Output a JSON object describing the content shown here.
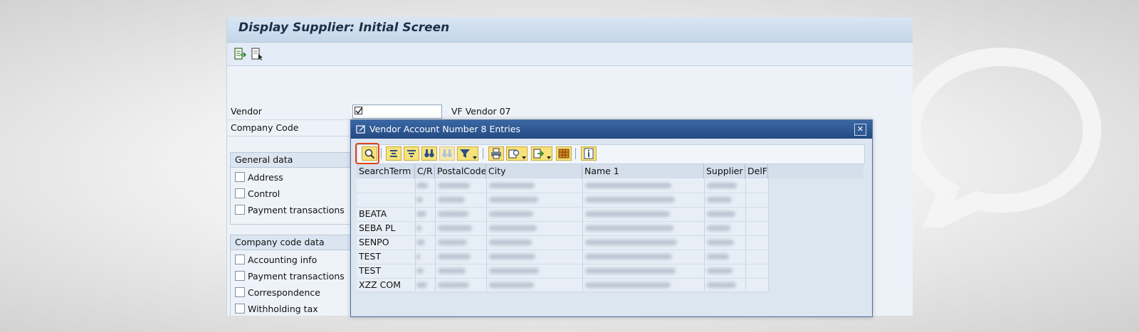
{
  "screen": {
    "title": "Display Supplier:  Initial Screen"
  },
  "form": {
    "vendor_label": "Vendor",
    "vendor_value": "VF Vendor 07",
    "company_code_label": "Company Code",
    "general_data": {
      "title": "General data",
      "items": [
        "Address",
        "Control",
        "Payment transactions"
      ]
    },
    "company_code_data": {
      "title": "Company code data",
      "items": [
        "Accounting info",
        "Payment transactions",
        "Correspondence",
        "Withholding tax"
      ]
    }
  },
  "dialog": {
    "title": "Vendor Account Number 8 Entries",
    "close_glyph": "✕",
    "columns": [
      "SearchTerm",
      "C/R",
      "PostalCode",
      "City",
      "Name 1",
      "Supplier",
      "DelF"
    ],
    "search_terms": [
      "",
      "",
      "BEATA",
      "SEBA PL",
      "SENPO",
      "TEST",
      "TEST",
      "XZZ COM"
    ]
  },
  "colors": {
    "accent": "#e0421a",
    "dialog_title": "#2f5b95",
    "toolbar_button": "#f7e27a"
  }
}
